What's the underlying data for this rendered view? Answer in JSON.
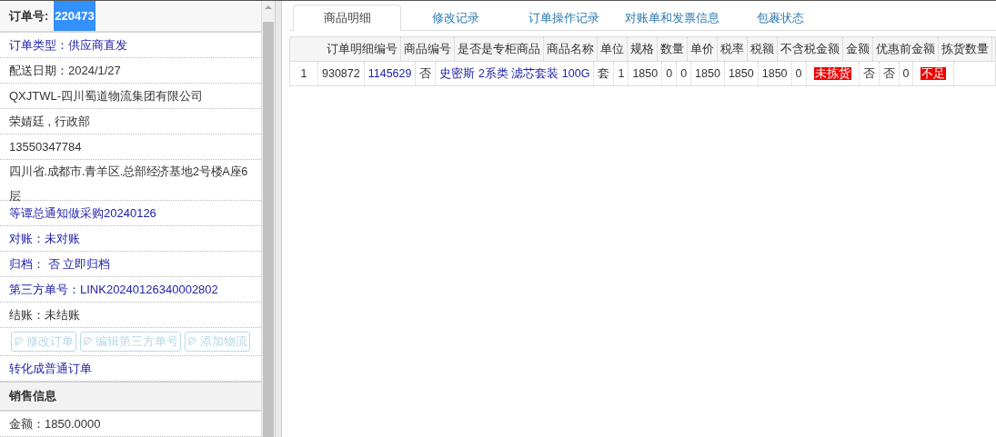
{
  "order_header": {
    "label": "订单号:",
    "value": "220473",
    "value_selected": true
  },
  "details": [
    {
      "text": "订单类型：供应商直发",
      "kind": "link"
    },
    {
      "text": "配送日期：2024/1/27",
      "kind": "plain"
    },
    {
      "text": "QXJTWL-四川蜀道物流集团有限公司",
      "kind": "plain"
    },
    {
      "text": "荣婧廷 , 行政部",
      "kind": "plain"
    },
    {
      "text": "13550347784",
      "kind": "plain"
    },
    {
      "text": "四川省.成都市.青羊区.总部经济基地2号楼A座6层",
      "kind": "plain"
    },
    {
      "text": "等谭总通知做采购20240126",
      "kind": "link"
    },
    {
      "text": "对账：未对账",
      "kind": "link"
    },
    {
      "text": "归档： 否 立即归档",
      "kind": "link"
    },
    {
      "text": "第三方单号：LINK20240126340002802",
      "kind": "link"
    },
    {
      "text": "结账：未结账",
      "kind": "plain"
    }
  ],
  "action_buttons": [
    {
      "label": "修改订单",
      "disabled": true
    },
    {
      "label": "编辑第三方单号",
      "disabled": true
    },
    {
      "label": "添加物流",
      "disabled": true
    }
  ],
  "convert_link": "转化成普通订单",
  "sales_section": {
    "title": "销售信息",
    "amount": "金额：1850.0000"
  },
  "tabs": [
    {
      "label": "商品明细",
      "selected": true
    },
    {
      "label": "修改记录",
      "selected": false
    },
    {
      "label": "订单操作记录",
      "selected": false
    },
    {
      "label": "对账单和发票信息",
      "selected": false
    },
    {
      "label": "包裹状态",
      "selected": false
    }
  ],
  "item_grid": {
    "header_strip": [
      "订单明细编号",
      "商品编号",
      "是否是专柜商品",
      "商品名称",
      "单位",
      "规格",
      "数量",
      "单价",
      "税率",
      "税额",
      "不含税金额",
      "金额",
      "优惠前金额",
      "拣货数量"
    ],
    "item_strips": [
      {
        "entries": [
          {
            "text": "1",
            "kind": "plain"
          },
          {
            "text": "930872",
            "kind": "plain"
          },
          {
            "text": "1145629",
            "kind": "link"
          },
          {
            "text": "否",
            "kind": "plain"
          },
          {
            "text": "史密斯 2系类 滤芯套装 100G",
            "kind": "link"
          },
          {
            "text": "套",
            "kind": "plain"
          },
          {
            "text": "1",
            "kind": "plain"
          },
          {
            "text": "1850",
            "kind": "plain"
          },
          {
            "text": "0",
            "kind": "plain"
          },
          {
            "text": "0",
            "kind": "plain"
          },
          {
            "text": "1850",
            "kind": "plain"
          },
          {
            "text": "1850",
            "kind": "plain"
          },
          {
            "text": "1850",
            "kind": "plain"
          },
          {
            "text": "0",
            "kind": "plain"
          },
          {
            "text": "未拣货",
            "kind": "alert"
          },
          {
            "text": "否",
            "kind": "plain"
          },
          {
            "text": "否",
            "kind": "plain"
          },
          {
            "text": "0",
            "kind": "plain"
          },
          {
            "text": "不足",
            "kind": "alert"
          }
        ]
      }
    ]
  }
}
